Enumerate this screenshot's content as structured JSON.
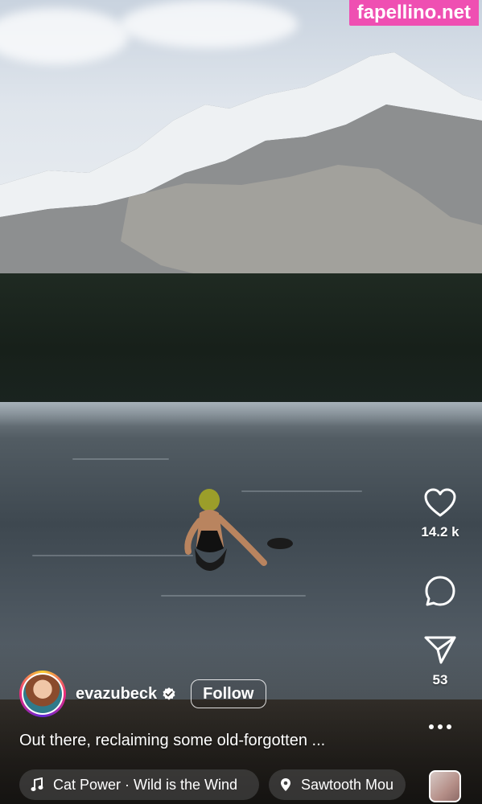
{
  "watermark": "fapellino.net",
  "actions": {
    "like_count": "14.2 k",
    "share_count": "53"
  },
  "author": {
    "username": "evazubeck",
    "follow_label": "Follow"
  },
  "caption": "Out there, reclaiming some old-forgotten ...",
  "audio": {
    "label": "Cat Power · Wild is the Wind"
  },
  "location": {
    "label": "Sawtooth Mou"
  },
  "icons": {
    "like": "heart-icon",
    "comment": "comment-icon",
    "share": "send-icon",
    "more": "more-icon",
    "verified": "verified-badge-icon",
    "music": "music-note-icon",
    "location": "location-pin-icon"
  },
  "colors": {
    "watermark_bg": "#ef4fb2",
    "verified_badge": "#ffffff"
  }
}
